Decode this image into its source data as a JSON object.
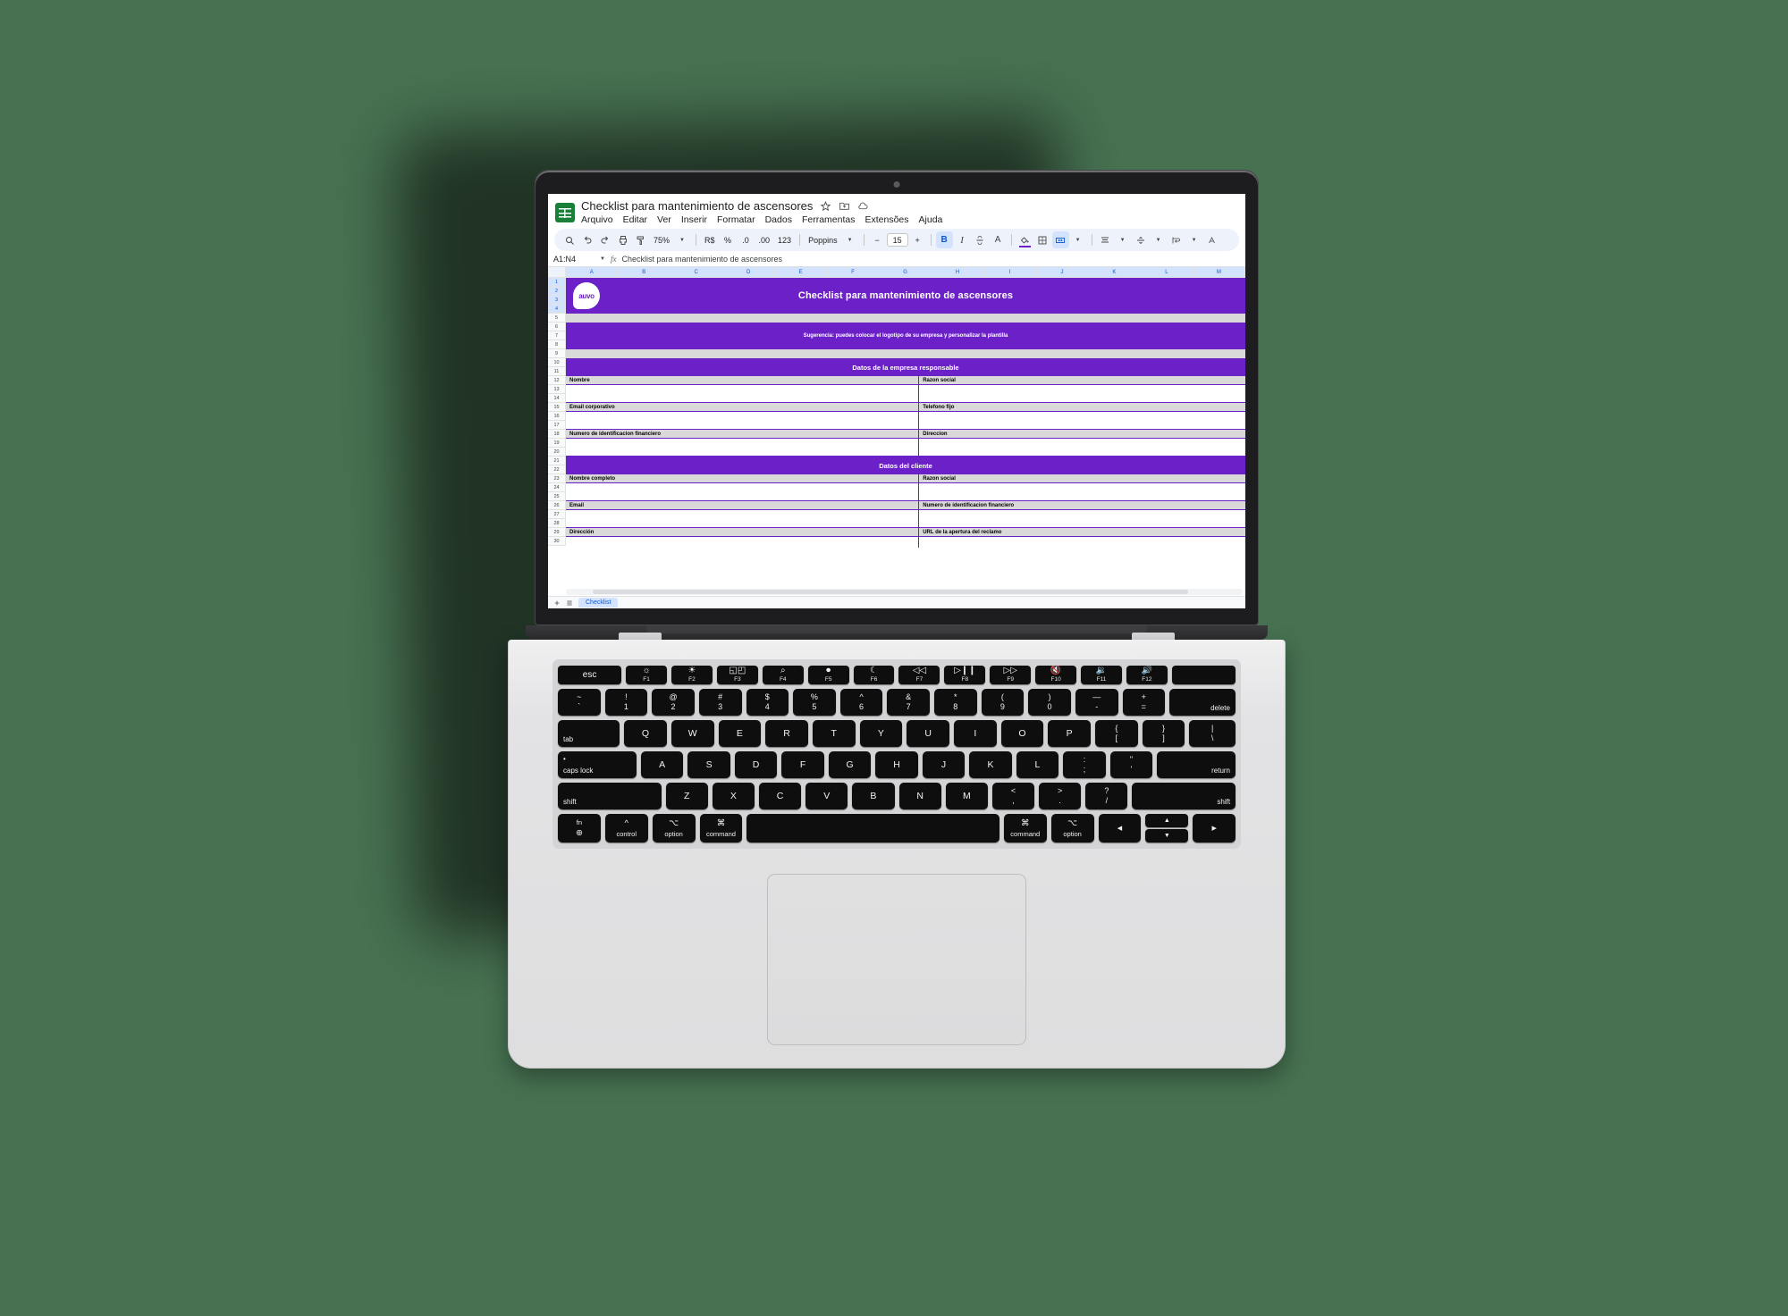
{
  "background_color": "#477151",
  "brand_purple": "#6c21c8",
  "app": {
    "logo_icon": "google-sheets-icon",
    "document_title": "Checklist para mantenimiento de ascensores",
    "title_icons": [
      {
        "name": "star-icon",
        "label": "Destacar"
      },
      {
        "name": "move-to-folder-icon",
        "label": "Mover"
      },
      {
        "name": "cloud-saved-icon",
        "label": "Guardado en Drive"
      }
    ],
    "menus": [
      "Arquivo",
      "Editar",
      "Ver",
      "Inserir",
      "Formatar",
      "Dados",
      "Ferramentas",
      "Extensões",
      "Ajuda"
    ]
  },
  "toolbar": {
    "items": [
      {
        "name": "search-icon",
        "type": "icon"
      },
      {
        "name": "undo-icon",
        "type": "icon"
      },
      {
        "name": "redo-icon",
        "type": "icon"
      },
      {
        "name": "print-icon",
        "type": "icon"
      },
      {
        "name": "paint-format-icon",
        "type": "icon"
      }
    ],
    "zoom_value": "75%",
    "currency_label": "R$",
    "percent_label": "%",
    "decrease_decimal_label": ".0",
    "increase_decimal_label": ".00",
    "number_format_label": "123",
    "font_name": "Poppins",
    "font_size_decrease": "−",
    "font_size": "15",
    "font_size_increase": "+",
    "bold_label": "B",
    "italic_label": "I",
    "strikethrough_label": "S",
    "text_color_label": "A",
    "fill_color_name": "fill-color-icon",
    "borders_name": "borders-icon",
    "merge_cells_name": "merge-cells-icon",
    "horizontal_align_name": "horizontal-align-icon",
    "vertical_align_name": "vertical-align-icon",
    "text_wrap_name": "text-wrap-icon"
  },
  "formula_bar": {
    "name_box": "A1:N4",
    "fx_label": "fx",
    "value": "Checklist para mantenimiento de ascensores"
  },
  "grid": {
    "columns": [
      "A",
      "B",
      "C",
      "D",
      "E",
      "F",
      "G",
      "H",
      "I",
      "J",
      "K",
      "L",
      "M"
    ],
    "selected_columns": [
      "A",
      "B",
      "C",
      "D",
      "E",
      "F",
      "G",
      "H",
      "I",
      "J",
      "K",
      "L",
      "M"
    ],
    "rows": [
      1,
      2,
      3,
      4,
      5,
      6,
      7,
      8,
      9,
      10,
      11,
      12,
      13,
      14,
      15,
      16,
      17,
      18,
      19,
      20,
      21,
      22,
      23,
      24,
      25,
      26,
      27,
      28,
      29,
      30
    ],
    "selected_rows": [
      1,
      2,
      3,
      4
    ]
  },
  "sheet": {
    "logo_text": "auvo",
    "title": "Checklist para mantenimiento de ascensores",
    "suggestion": "Sugerencia: puedes colocar el logotipo de su empresa y personalizar la plantilla",
    "sections": [
      {
        "heading": "Datos de la empresa responsable",
        "field_pairs": [
          {
            "left": "Nombre",
            "right": "Razon social"
          },
          {
            "left": "Email corporativo",
            "right": "Telefono fijo"
          },
          {
            "left": "Numero de identificacion financiero",
            "right": "Direccion"
          }
        ]
      },
      {
        "heading": "Datos del cliente",
        "field_pairs": [
          {
            "left": "Nombre completo",
            "right": "Razon social"
          },
          {
            "left": "Email",
            "right": "Numero de identificacion financiero"
          },
          {
            "left": "Dirección",
            "right": "URL de la apertura del reclamo"
          }
        ]
      }
    ]
  },
  "sheet_tabs": {
    "add_sheet_icon": "add-sheet-icon",
    "all_sheets_icon": "all-sheets-icon",
    "active_tab": "Checklist"
  },
  "keyboard": {
    "fn_row": [
      {
        "label": "esc",
        "glyph": "",
        "wide": true
      },
      {
        "label": "F1",
        "glyph": "☼",
        "name": "brightness-down-icon"
      },
      {
        "label": "F2",
        "glyph": "☀",
        "name": "brightness-up-icon"
      },
      {
        "label": "F3",
        "glyph": "◱◰",
        "name": "mission-control-icon"
      },
      {
        "label": "F4",
        "glyph": "⌕",
        "name": "spotlight-search-icon"
      },
      {
        "label": "F5",
        "glyph": "⏺",
        "name": "dictation-icon"
      },
      {
        "label": "F6",
        "glyph": "☾",
        "name": "do-not-disturb-icon"
      },
      {
        "label": "F7",
        "glyph": "◁◁",
        "name": "rewind-icon"
      },
      {
        "label": "F8",
        "glyph": "▷❙❙",
        "name": "play-pause-icon"
      },
      {
        "label": "F9",
        "glyph": "▷▷",
        "name": "fast-forward-icon"
      },
      {
        "label": "F10",
        "glyph": "🔇",
        "name": "mute-icon"
      },
      {
        "label": "F11",
        "glyph": "🔉",
        "name": "volume-down-icon"
      },
      {
        "label": "F12",
        "glyph": "🔊",
        "name": "volume-up-icon"
      },
      {
        "label": "",
        "glyph": "",
        "name": "touch-id-key",
        "wide": true
      }
    ],
    "number_row": [
      {
        "top": "~",
        "bot": "`"
      },
      {
        "top": "!",
        "bot": "1"
      },
      {
        "top": "@",
        "bot": "2"
      },
      {
        "top": "#",
        "bot": "3"
      },
      {
        "top": "$",
        "bot": "4"
      },
      {
        "top": "%",
        "bot": "5"
      },
      {
        "top": "^",
        "bot": "6"
      },
      {
        "top": "&",
        "bot": "7"
      },
      {
        "top": "*",
        "bot": "8"
      },
      {
        "top": "(",
        "bot": "9"
      },
      {
        "top": ")",
        "bot": "0"
      },
      {
        "top": "—",
        "bot": "-"
      },
      {
        "top": "+",
        "bot": "="
      }
    ],
    "delete_label": "delete",
    "tab_label": "tab",
    "qwerty_row": [
      "Q",
      "W",
      "E",
      "R",
      "T",
      "Y",
      "U",
      "I",
      "O",
      "P"
    ],
    "bracket_keys": [
      {
        "top": "{",
        "bot": "["
      },
      {
        "top": "}",
        "bot": "]"
      },
      {
        "top": "|",
        "bot": "\\"
      }
    ],
    "caps_label": "caps lock",
    "asdf_row": [
      "A",
      "S",
      "D",
      "F",
      "G",
      "H",
      "J",
      "K",
      "L"
    ],
    "punct_keys": [
      {
        "top": ":",
        "bot": ";"
      },
      {
        "top": "\"",
        "bot": "'"
      }
    ],
    "return_label": "return",
    "shift_label": "shift",
    "zxcv_row": [
      "Z",
      "X",
      "C",
      "V",
      "B",
      "N",
      "M"
    ],
    "zxcv_punct": [
      {
        "top": "<",
        "bot": ","
      },
      {
        "top": ">",
        "bot": "."
      },
      {
        "top": "?",
        "bot": "/"
      }
    ],
    "fn_label": "fn",
    "globe_glyph": "⊕",
    "control_label": "control",
    "control_glyph": "^",
    "option_label": "option",
    "option_glyph": "⌥",
    "command_label": "command",
    "command_glyph": "⌘",
    "arrow_left": "◀",
    "arrow_up": "▲",
    "arrow_down": "▼",
    "arrow_right": "▶"
  }
}
